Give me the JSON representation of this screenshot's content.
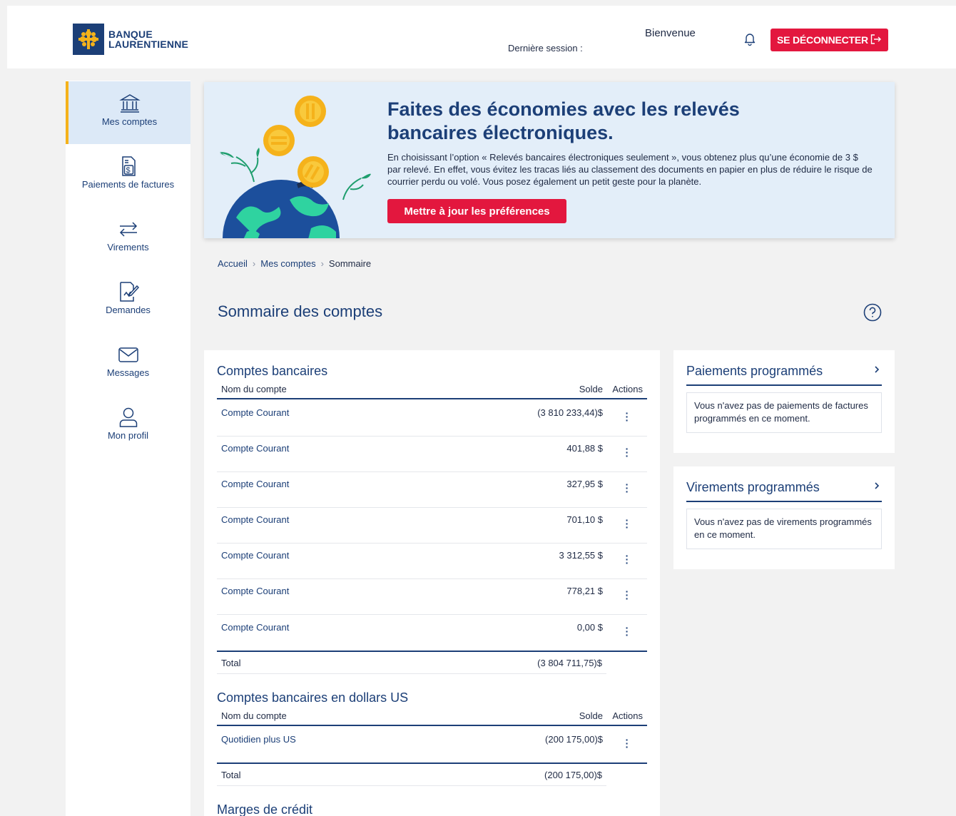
{
  "header": {
    "brand_line1": "BANQUE",
    "brand_line2": "LAURENTIENNE",
    "last_session_label": "Dernière session :",
    "welcome": "Bienvenue",
    "logout_label": "SE DÉCONNECTER",
    "logout_icon": "logout-arrow-icon",
    "bell_icon": "bell-icon"
  },
  "sidebar": {
    "items": [
      {
        "label": "Mes comptes",
        "icon": "bank-icon",
        "active": true
      },
      {
        "label": "Paiements de factures",
        "icon": "bill-icon",
        "active": false
      },
      {
        "label": "Virements",
        "icon": "transfer-arrows-icon",
        "active": false
      },
      {
        "label": "Demandes",
        "icon": "request-doc-icon",
        "active": false
      },
      {
        "label": "Messages",
        "icon": "envelope-icon",
        "active": false
      },
      {
        "label": "Mon profil",
        "icon": "user-icon",
        "active": false
      }
    ]
  },
  "banner": {
    "title": "Faites des économies avec les relevés bancaires électroniques.",
    "text": "En choisissant l’option « Relevés bancaires électroniques seulement », vous obtenez plus qu’une économie de 3 $ par relevé. En effet, vous évitez les tracas liés au classement des documents en papier en plus de réduire le risque de courrier perdu ou volé. Vous posez également un petit geste pour la planète.",
    "button_label": "Mettre à jour les préférences"
  },
  "breadcrumb": [
    "Accueil",
    "Mes comptes",
    "Sommaire"
  ],
  "page_title": "Sommaire des comptes",
  "sections": {
    "bank": {
      "title": "Comptes bancaires",
      "col_name": "Nom du compte",
      "col_balance": "Solde",
      "col_actions": "Actions",
      "rows": [
        {
          "name": "Compte Courant",
          "balance": "(3 810 233,44)$"
        },
        {
          "name": "Compte Courant",
          "balance": "401,88 $"
        },
        {
          "name": "Compte Courant",
          "balance": "327,95 $"
        },
        {
          "name": "Compte Courant",
          "balance": "701,10 $"
        },
        {
          "name": "Compte Courant",
          "balance": "3 312,55 $"
        },
        {
          "name": "Compte Courant",
          "balance": "778,21 $"
        },
        {
          "name": "Compte Courant",
          "balance": "0,00 $"
        }
      ],
      "total_label": "Total",
      "total_value": "(3 804 711,75)$"
    },
    "us": {
      "title": "Comptes bancaires en dollars US",
      "col_name": "Nom du compte",
      "col_balance": "Solde",
      "col_actions": "Actions",
      "rows": [
        {
          "name": "Quotidien plus US",
          "balance": "(200 175,00)$"
        }
      ],
      "total_label": "Total",
      "total_value": "(200 175,00)$"
    },
    "credit": {
      "title": "Marges de crédit"
    }
  },
  "scheduled_payments": {
    "title": "Paiements programmés",
    "message": "Vous n'avez pas de paiements de factures programmés en ce moment."
  },
  "scheduled_transfers": {
    "title": "Virements programmés",
    "message": "Vous n'avez pas de virements programmés en ce moment."
  },
  "colors": {
    "brand_blue": "#1c3f77",
    "accent_red": "#e3173e",
    "active_bar": "#f5b21b"
  }
}
